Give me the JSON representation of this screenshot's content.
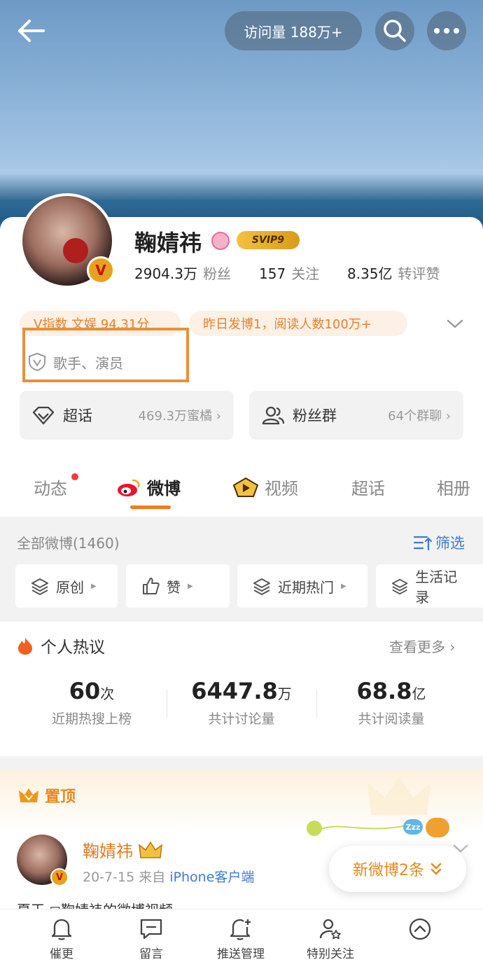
{
  "header": {
    "visits_label": "访问量 188万+"
  },
  "profile": {
    "name": "鞠婧祎",
    "svip_label": "SVIP9",
    "verified_badge": "V",
    "stats": [
      {
        "value": "2904.3万",
        "label": "粉丝"
      },
      {
        "value": "157",
        "label": "关注"
      },
      {
        "value": "8.35亿",
        "label": "转评赞"
      }
    ],
    "tags": [
      "V指数 文娱 94.31分",
      "昨日发博1，阅读人数100万+"
    ],
    "profession": "歌手、演员",
    "tiles": [
      {
        "title": "超话",
        "sub": "469.3万蜜橘"
      },
      {
        "title": "粉丝群",
        "sub": "64个群聊"
      }
    ]
  },
  "tabs": [
    {
      "label": "动态"
    },
    {
      "label": "微博"
    },
    {
      "label": "视频"
    },
    {
      "label": "超话"
    },
    {
      "label": "相册"
    }
  ],
  "weibo_list": {
    "all_label": "全部微博(1460)",
    "filter_label": "筛选",
    "chips": [
      "原创",
      "赞",
      "近期热门",
      "生活记录"
    ]
  },
  "hot_discussion": {
    "title": "个人热议",
    "more_label": "查看更多",
    "metrics": [
      {
        "num": "60",
        "unit": "次",
        "desc": "近期热搜上榜"
      },
      {
        "num": "6447.8",
        "unit": "万",
        "desc": "共计讨论量"
      },
      {
        "num": "68.8",
        "unit": "亿",
        "desc": "共计阅读量"
      }
    ]
  },
  "pinned": {
    "label": "置顶",
    "author": "鞠婧祎",
    "date": "20-7-15",
    "from_label": "来自",
    "source": "iPhone客户端",
    "text_preview": "夏天 ◻鞠婧祎的微博视频",
    "zz": "Zzz"
  },
  "new_weibo_label": "新微博2条",
  "bottom_nav": [
    {
      "label": "催更",
      "icon": "bell-icon"
    },
    {
      "label": "留言",
      "icon": "message-icon"
    },
    {
      "label": "推送管理",
      "icon": "bell-plus-icon"
    },
    {
      "label": "特别关注",
      "icon": "star-user-icon"
    },
    {
      "label": "",
      "icon": "scroll-top-icon"
    }
  ]
}
